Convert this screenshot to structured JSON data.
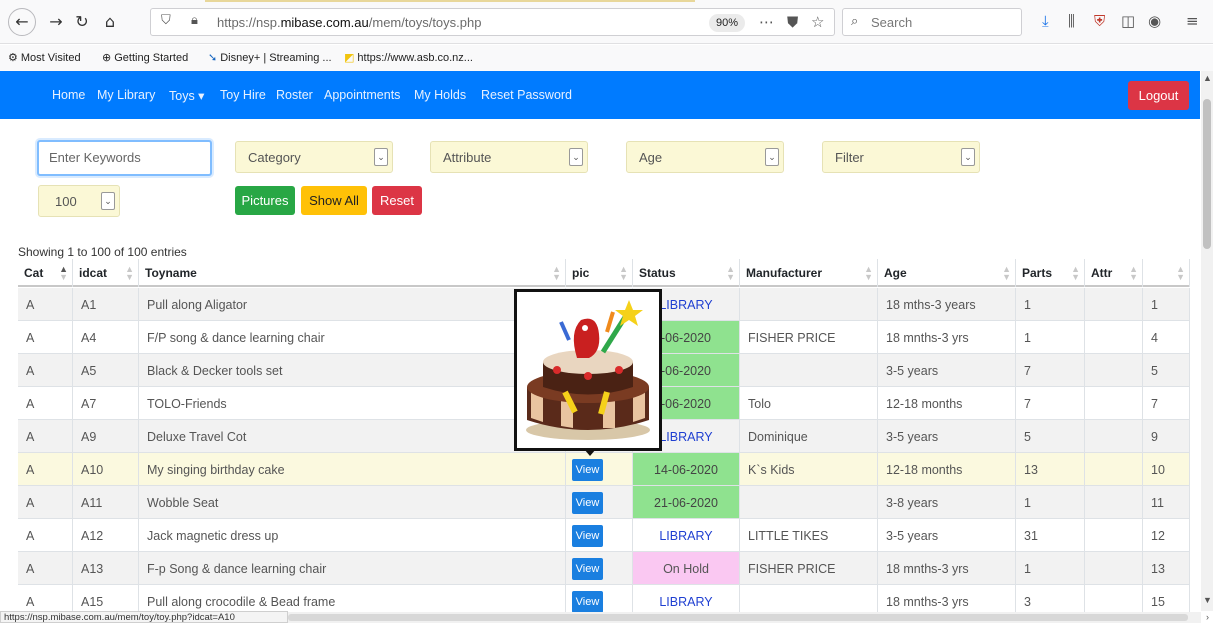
{
  "browser": {
    "zoom": "90%",
    "url_prefix": "https://nsp.",
    "url_domain": "mibase.com.au",
    "url_path": "/mem/toys/toys.php",
    "search_placeholder": "Search",
    "bookmarks": [
      "Most Visited",
      "Getting Started",
      "Disney+ | Streaming ...",
      "https://www.asb.co.nz..."
    ],
    "status_url": "https://nsp.mibase.com.au/mem/toy/toy.php?idcat=A10"
  },
  "nav": {
    "items": [
      "Home",
      "My Library",
      "Toys ▾",
      "Toy Hire",
      "Roster",
      "Appointments",
      "My Holds",
      "Reset Password"
    ],
    "logout": "Logout"
  },
  "filters": {
    "keywords_placeholder": "Enter Keywords",
    "category": "Category",
    "attribute": "Attribute",
    "age": "Age",
    "filter": "Filter",
    "page_size": "100",
    "pictures": "Pictures",
    "show_all": "Show All",
    "reset": "Reset"
  },
  "table": {
    "info": "Showing 1 to 100 of 100 entries",
    "headers": [
      "Cat",
      "idcat",
      "Toyname",
      "pic",
      "Status",
      "Manufacturer",
      "Age",
      "Parts",
      "Attr",
      ""
    ],
    "view_label": "View",
    "rows": [
      {
        "cat": "A",
        "idcat": "A1",
        "toyname": "Pull along Aligator",
        "status": "LIBRARY",
        "status_type": "library",
        "manufacturer": "",
        "age": "18 mths-3 years",
        "parts": "1",
        "attr": "",
        "num": "1"
      },
      {
        "cat": "A",
        "idcat": "A4",
        "toyname": "F/P song & dance learning chair",
        "status": "-06-2020",
        "status_type": "date",
        "manufacturer": "FISHER PRICE",
        "age": "18 mnths-3 yrs",
        "parts": "1",
        "attr": "",
        "num": "4"
      },
      {
        "cat": "A",
        "idcat": "A5",
        "toyname": "Black & Decker tools set",
        "status": "-06-2020",
        "status_type": "date",
        "manufacturer": "",
        "age": "3-5 years",
        "parts": "7",
        "attr": "",
        "num": "5"
      },
      {
        "cat": "A",
        "idcat": "A7",
        "toyname": "TOLO-Friends",
        "status": "-06-2020",
        "status_type": "date",
        "manufacturer": "Tolo",
        "age": "12-18 months",
        "parts": "7",
        "attr": "",
        "num": "7"
      },
      {
        "cat": "A",
        "idcat": "A9",
        "toyname": "Deluxe Travel Cot",
        "status": "LIBRARY",
        "status_type": "library",
        "manufacturer": "Dominique",
        "age": "3-5 years",
        "parts": "5",
        "attr": "",
        "num": "9"
      },
      {
        "cat": "A",
        "idcat": "A10",
        "toyname": "My singing birthday cake",
        "status": "14-06-2020",
        "status_type": "date",
        "manufacturer": "K`s Kids",
        "age": "12-18 months",
        "parts": "13",
        "attr": "",
        "num": "10"
      },
      {
        "cat": "A",
        "idcat": "A11",
        "toyname": "Wobble Seat",
        "status": "21-06-2020",
        "status_type": "date",
        "manufacturer": "",
        "age": "3-8 years",
        "parts": "1",
        "attr": "",
        "num": "11"
      },
      {
        "cat": "A",
        "idcat": "A12",
        "toyname": "Jack magnetic dress up",
        "status": "LIBRARY",
        "status_type": "library",
        "manufacturer": "LITTLE TIKES",
        "age": "3-5 years",
        "parts": "31",
        "attr": "",
        "num": "12"
      },
      {
        "cat": "A",
        "idcat": "A13",
        "toyname": "F-p Song & dance learning chair",
        "status": "On Hold",
        "status_type": "hold",
        "manufacturer": "FISHER PRICE",
        "age": "18 mnths-3 yrs",
        "parts": "1",
        "attr": "",
        "num": "13"
      },
      {
        "cat": "A",
        "idcat": "A15",
        "toyname": "Pull along crocodile & Bead frame",
        "status": "LIBRARY",
        "status_type": "library",
        "manufacturer": "",
        "age": "18 mnths-3 yrs",
        "parts": "3",
        "attr": "",
        "num": "15"
      }
    ]
  },
  "colors": {
    "navbar": "#007bff",
    "logout": "#dc3545",
    "pictures": "#28a745",
    "show_all": "#ffc107",
    "reset": "#dc3545",
    "status_date": "#8fe28f",
    "status_hold": "#fac8f2",
    "library_text": "#1f3fd1"
  }
}
